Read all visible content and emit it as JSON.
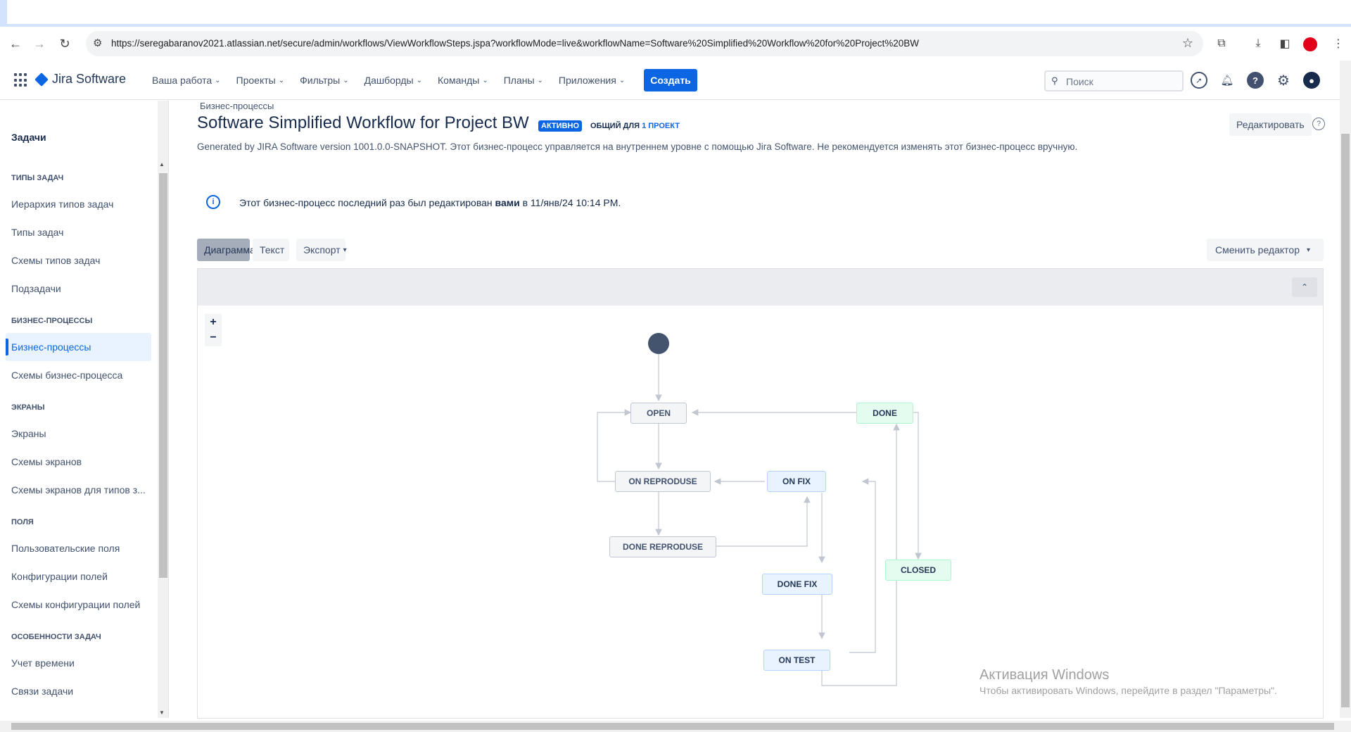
{
  "browser": {
    "url": "https://seregabaranov2021.atlassian.net/secure/admin/workflows/ViewWorkflowSteps.jspa?workflowMode=live&workflowName=Software%20Simplified%20Workflow%20for%20Project%20BW"
  },
  "nav": {
    "logo": "Jira Software",
    "menu": [
      "Ваша работа",
      "Проекты",
      "Фильтры",
      "Дашборды",
      "Команды",
      "Планы",
      "Приложения"
    ],
    "create": "Создать",
    "search_placeholder": "Поиск"
  },
  "sidebar": {
    "title": "Задачи",
    "sections": [
      {
        "heading": "ТИПЫ ЗАДАЧ",
        "items": [
          "Иерархия типов задач",
          "Типы задач",
          "Схемы типов задач",
          "Подзадачи"
        ]
      },
      {
        "heading": "БИЗНЕС-ПРОЦЕССЫ",
        "items": [
          "Бизнес-процессы",
          "Схемы бизнес-процесса"
        ]
      },
      {
        "heading": "ЭКРАНЫ",
        "items": [
          "Экраны",
          "Схемы экранов",
          "Схемы экранов для типов з..."
        ]
      },
      {
        "heading": "ПОЛЯ",
        "items": [
          "Пользовательские поля",
          "Конфигурации полей",
          "Схемы конфигурации полей"
        ]
      },
      {
        "heading": "ОСОБЕННОСТИ ЗАДАЧ",
        "items": [
          "Учет времени",
          "Связи задачи"
        ]
      }
    ],
    "active_item": "Бизнес-процессы"
  },
  "page": {
    "breadcrumb": "Бизнес-процессы",
    "title": "Software Simplified Workflow for Project BW",
    "badge": "АКТИВНО",
    "shared_prefix": "ОБЩИЙ ДЛЯ",
    "shared_link": "1 ПРОЕКТ",
    "edit": "Редактировать",
    "description": "Generated by JIRA Software version 1001.0.0-SNAPSHOT. Этот бизнес-процесс управляется на внутреннем уровне с помощью Jira Software. Не рекомендуется изменять этот бизнес-процесс вручную.",
    "info_before": "Этот бизнес-процесс последний раз был редактирован",
    "info_who": "вами",
    "info_after": "в 11/янв/24 10:14 PM.",
    "tabs": [
      "Диаграмма",
      "Текст",
      "Экспорт"
    ],
    "switch_editor": "Сменить редактор"
  },
  "diagram": {
    "zoom_in": "+",
    "zoom_out": "−",
    "statuses": {
      "open": "OPEN",
      "on_reproduse": "ON REPRODUSE",
      "done_reproduse": "DONE REPRODUSE",
      "on_fix": "ON FIX",
      "done_fix": "DONE FIX",
      "on_test": "ON TEST",
      "done": "DONE",
      "closed": "CLOSED"
    }
  },
  "watermark": {
    "line1": "Активация Windows",
    "line2": "Чтобы активировать Windows, перейдите в раздел \"Параметры\"."
  }
}
